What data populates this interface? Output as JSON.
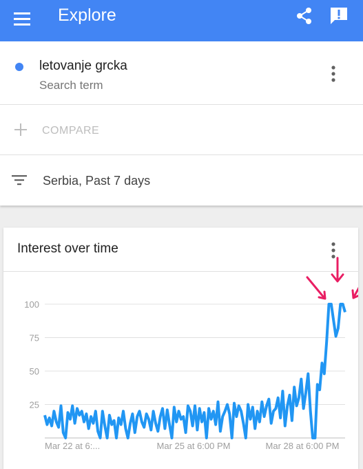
{
  "appbar": {
    "title": "Explore",
    "menu_icon": "hamburger-menu-icon",
    "share_icon": "share-icon",
    "feedback_icon": "feedback-icon",
    "color": "#4285f4"
  },
  "search": {
    "term": "letovanje grcka",
    "subtitle": "Search term",
    "dot_color": "#4285f4"
  },
  "compare": {
    "label": "COMPARE"
  },
  "filter": {
    "label": "Serbia, Past 7 days"
  },
  "interest_card": {
    "title": "Interest over time"
  },
  "chart_data": {
    "type": "line",
    "title": "Interest over time",
    "xlabel": "",
    "ylabel": "",
    "ylim": [
      0,
      100
    ],
    "yticks": [
      25,
      50,
      75,
      100
    ],
    "grid": true,
    "xtick_labels": [
      "Mar 22 at 6:...",
      "Mar 25 at 6:00 PM",
      "Mar 28 at 6:00 PM"
    ],
    "line_color": "#2196f3",
    "series": [
      {
        "values": [
          17,
          10,
          15,
          9,
          20,
          12,
          8,
          24,
          4,
          0,
          19,
          14,
          24,
          11,
          22,
          17,
          20,
          12,
          18,
          7,
          16,
          11,
          20,
          5,
          0,
          20,
          9,
          0,
          17,
          10,
          13,
          0,
          15,
          10,
          20,
          7,
          0,
          11,
          18,
          4,
          16,
          20,
          12,
          8,
          18,
          14,
          6,
          20,
          11,
          5,
          16,
          22,
          7,
          21,
          10,
          0,
          23,
          12,
          20,
          14,
          16,
          4,
          24,
          20,
          9,
          24,
          6,
          22,
          12,
          19,
          0,
          22,
          14,
          20,
          10,
          27,
          5,
          16,
          20,
          25,
          18,
          0,
          26,
          16,
          24,
          20,
          11,
          0,
          25,
          14,
          23,
          7,
          20,
          12,
          27,
          16,
          24,
          29,
          11,
          20,
          22,
          30,
          15,
          35,
          9,
          24,
          32,
          13,
          38,
          24,
          30,
          44,
          22,
          34,
          48,
          20,
          0,
          0,
          40,
          36,
          56,
          48,
          72,
          100,
          100,
          88,
          76,
          82,
          100,
          100,
          94
        ]
      }
    ],
    "annotation": "pink hand-drawn arrows pointing at peak"
  }
}
